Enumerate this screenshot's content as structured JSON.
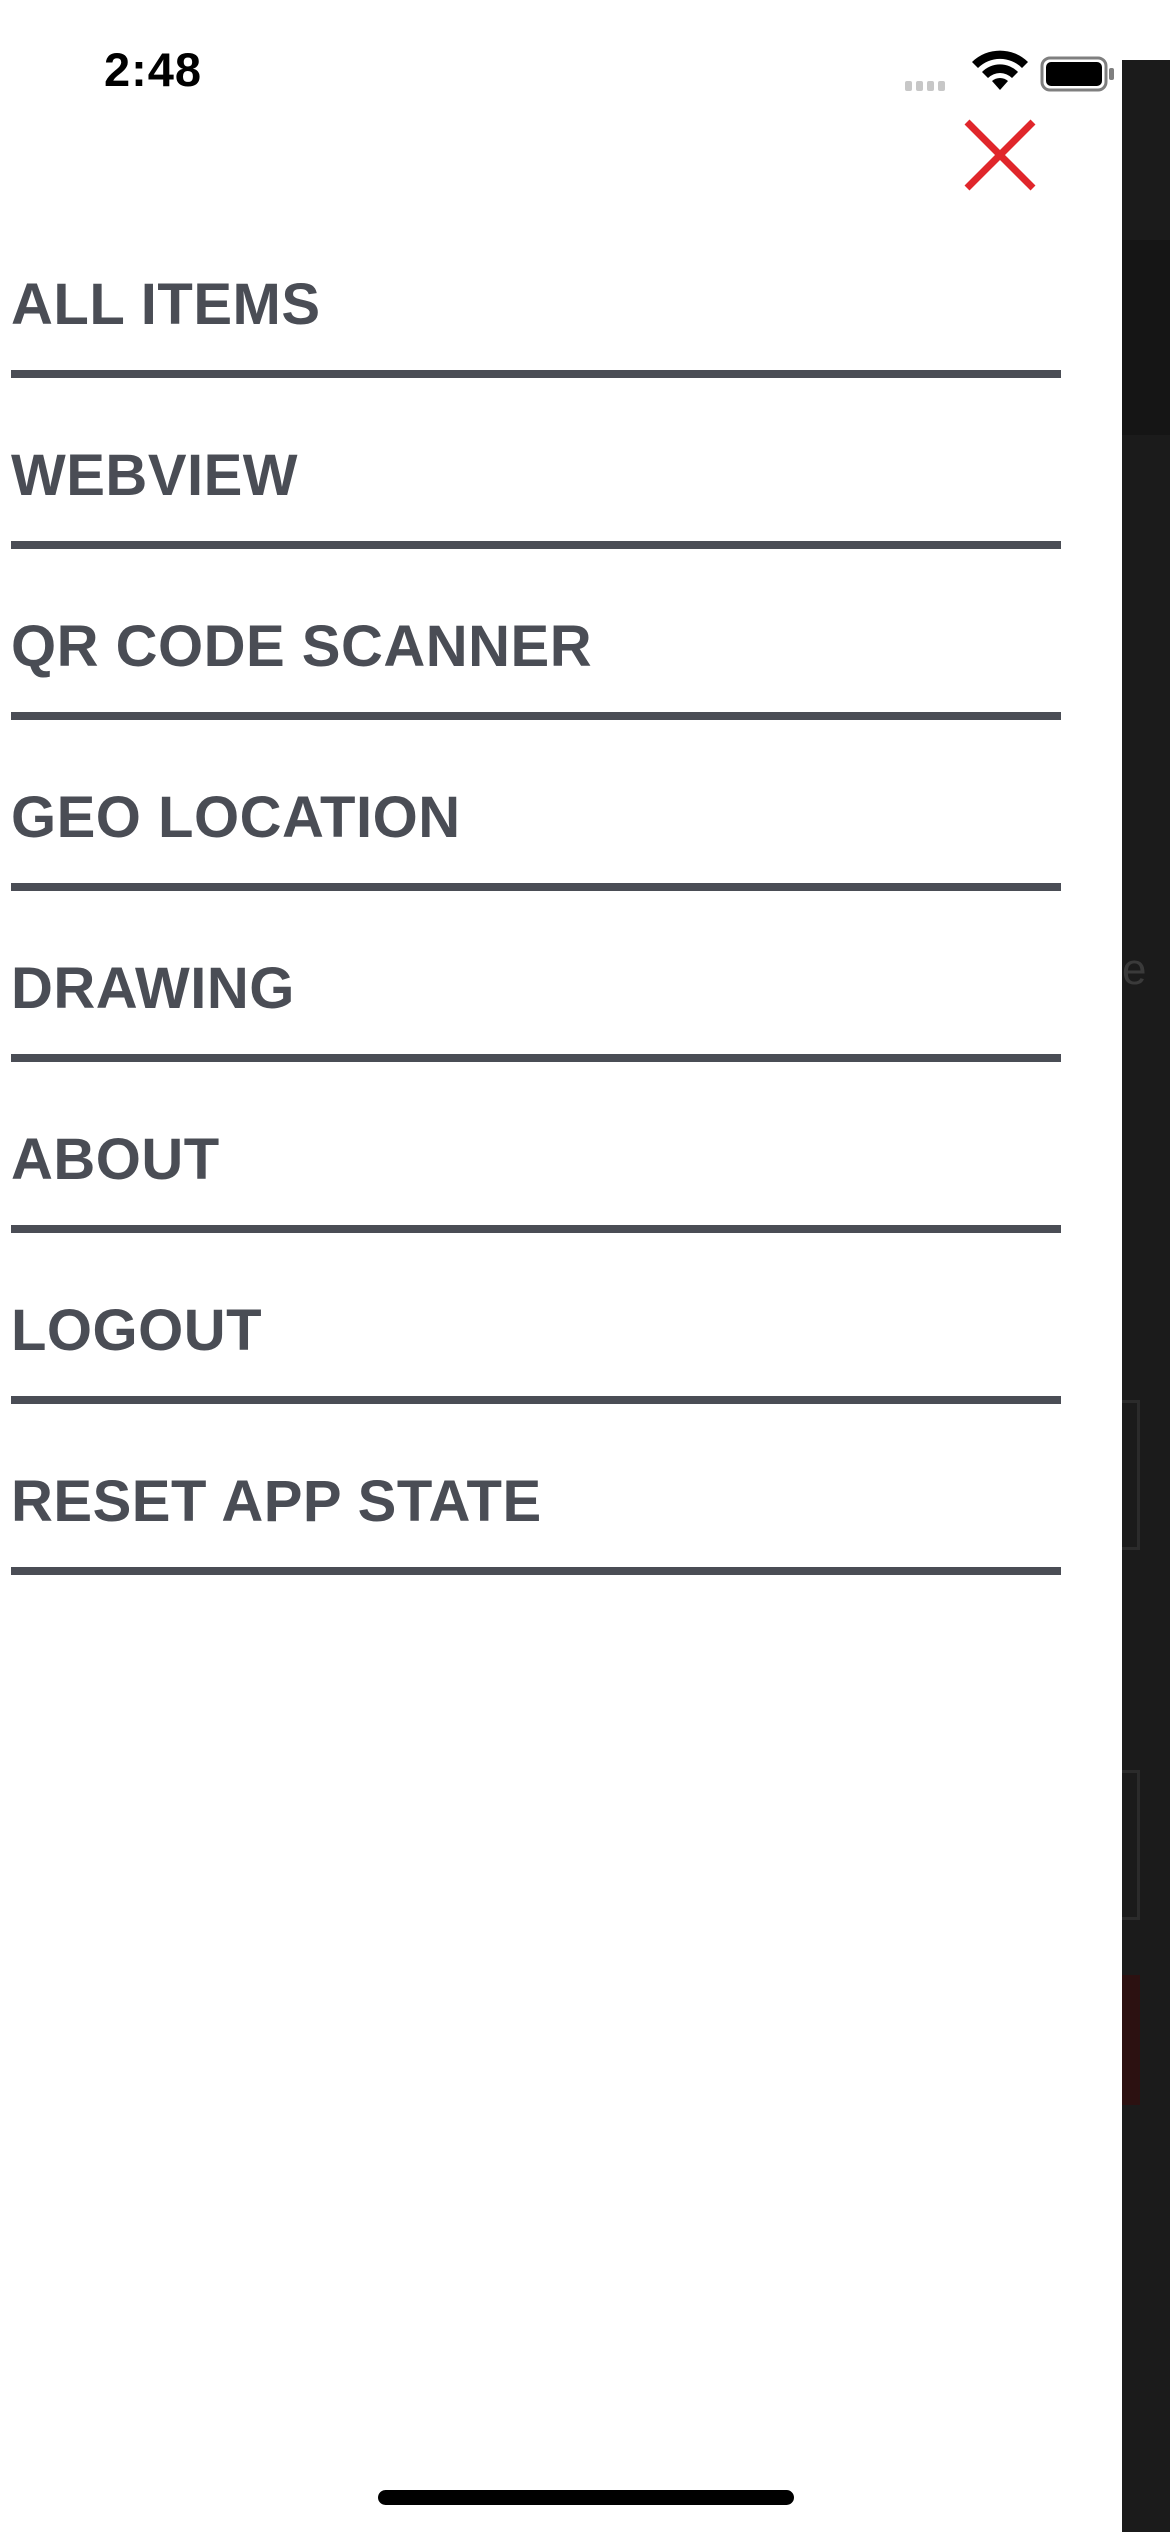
{
  "status_bar": {
    "time": "2:48",
    "signal_icon": "cellular-signal-icon",
    "wifi_icon": "wifi-icon",
    "battery_icon": "battery-icon"
  },
  "drawer": {
    "close_icon": "close-icon",
    "close_color": "#e0262b",
    "text_color": "#4a4d55",
    "items": [
      {
        "label": "ALL ITEMS"
      },
      {
        "label": "WEBVIEW"
      },
      {
        "label": "QR CODE SCANNER"
      },
      {
        "label": "GEO LOCATION"
      },
      {
        "label": "DRAWING"
      },
      {
        "label": "ABOUT"
      },
      {
        "label": "LOGOUT"
      },
      {
        "label": "RESET APP STATE"
      }
    ]
  },
  "backdrop_color": "#1b1b1b"
}
